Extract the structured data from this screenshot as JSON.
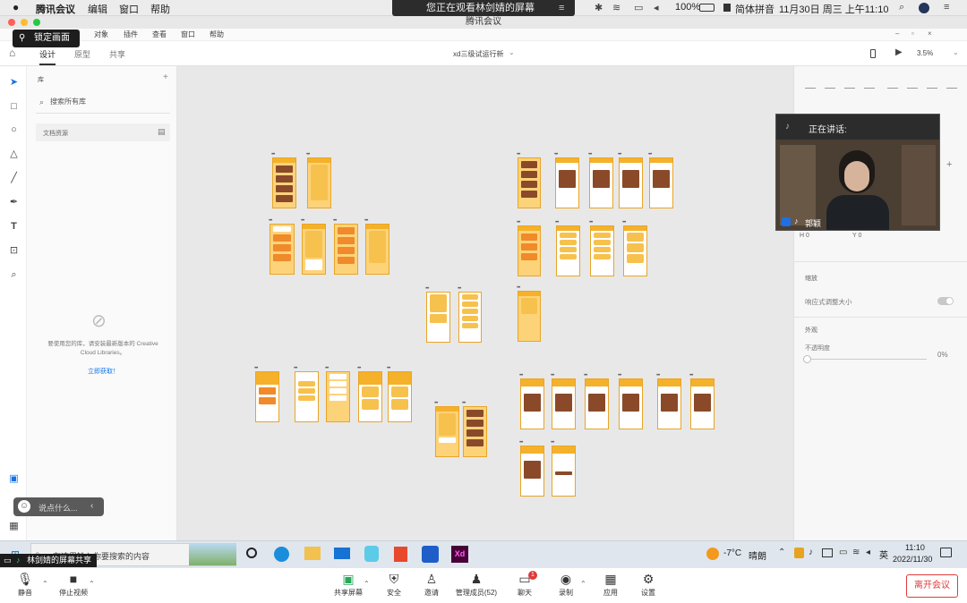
{
  "mac_menu": {
    "app": "腾讯会议",
    "items": [
      "编辑",
      "窗口",
      "帮助"
    ],
    "battery": "100%",
    "input_method": "简体拼音",
    "datetime": "11月30日 周三 上午11:10"
  },
  "share_banner": {
    "text": "您正在观看林剑婧的屏幕"
  },
  "window_title": "腾讯会议",
  "lock_screen": {
    "label": "锁定画面"
  },
  "xd_menu": [
    "对象",
    "插件",
    "查看",
    "窗口",
    "帮助"
  ],
  "xd_tabs": {
    "items": [
      "设计",
      "原型",
      "共享"
    ],
    "active": "设计"
  },
  "doc_title": "xd三级试运行新",
  "zoom": "3.5%",
  "library": {
    "title": "库",
    "search_placeholder": "搜索所有库",
    "doc_assets": "文档资源",
    "empty_text": "要使用您的库，请安装最新版本的 Creative Cloud Libraries。",
    "install_link": "立即获取！"
  },
  "video": {
    "speaking_label": "正在讲话:",
    "participant": "郭颖"
  },
  "right_panel": {
    "x_label": "H  0",
    "y_label": "Y  0",
    "responsive_title": "缩放",
    "responsive_label": "响应式调整大小",
    "appearance_title": "外观",
    "opacity_label": "不透明度",
    "opacity_value": "0%"
  },
  "chat_input": {
    "placeholder": "说点什么..."
  },
  "share_tag": {
    "text": "林剑婧的屏幕共享"
  },
  "taskbar": {
    "search_placeholder": "在这里输入你要搜索的内容",
    "weather_temp": "-7°C",
    "weather_desc": "晴朗",
    "ime": "英",
    "time": "11:10",
    "date": "2022/11/30"
  },
  "meeting_controls": {
    "mute": "静音",
    "stop_video": "停止视频",
    "share_screen": "共享屏幕",
    "security": "安全",
    "invite": "邀请",
    "manage_members": "管理成员(52)",
    "chat": "聊天",
    "chat_badge": "1",
    "record": "录制",
    "apps": "应用",
    "settings": "设置",
    "leave": "离开会议"
  },
  "colors": {
    "accent_orange": "#f5b12a",
    "artboard_fill": "#fdd37a",
    "leave_red": "#e03a3a",
    "link_blue": "#1473e6"
  }
}
